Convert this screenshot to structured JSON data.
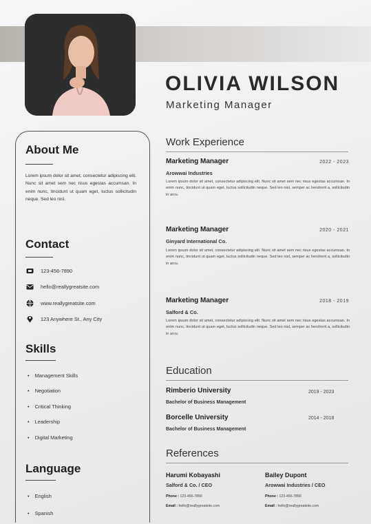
{
  "header": {
    "name": "OLIVIA WILSON",
    "role": "Marketing Manager"
  },
  "about": {
    "heading": "About Me",
    "text": "Lorem ipsum dolor sit amet, consectetur adipiscing elit. Nunc sit amet sem nec risus egestas accumsan. In enim nunc, tincidunt ut quam eget, luctus sollicitudin neque. Sed leo nisl."
  },
  "contact": {
    "heading": "Contact",
    "items": [
      {
        "icon": "phone-icon",
        "text": "123-456-7890"
      },
      {
        "icon": "mail-icon",
        "text": "hello@reallygreatsite.com"
      },
      {
        "icon": "globe-icon",
        "text": "www.reallygreatsite.com"
      },
      {
        "icon": "location-icon",
        "text": "123 Anywhere St., Any City"
      }
    ]
  },
  "skills": {
    "heading": "Skills",
    "items": [
      "Management Skills",
      "Negotiation",
      "Critical Thinking",
      "Leadership",
      "Digital Marketing"
    ]
  },
  "language": {
    "heading": "Language",
    "items": [
      "English",
      "Spanish"
    ]
  },
  "work": {
    "heading": "Work Experience",
    "jobs": [
      {
        "title": "Marketing Manager",
        "company": "Arowwai Industries",
        "dates": "2022 - 2023",
        "desc": "Lorem ipsum dolor sit amet, consectetur adipiscing elit. Nunc sit amet sem nec risus egestas accumsan. In enim nunc, tincidunt ut quam eget, luctus sollicitudin neque. Sed leo nisl, semper ac hendrerit a, sollicitudin in arcu."
      },
      {
        "title": "Marketing Manager",
        "company": "Ginyard International Co.",
        "dates": "2020 - 2021",
        "desc": "Lorem ipsum dolor sit amet, consectetur adipiscing elit. Nunc sit amet sem nec risus egestas accumsan. In enim nunc, tincidunt ut quam eget, luctus sollicitudin neque. Sed leo nisl, semper ac hendrerit a, sollicitudin in arcu."
      },
      {
        "title": "Marketing Manager",
        "company": "Salford & Co.",
        "dates": "2018 - 2019",
        "desc": "Lorem ipsum dolor sit amet, consectetur adipiscing elit. Nunc sit amet sem nec risus egestas accumsan. In enim nunc, tincidunt ut quam eget, luctus sollicitudin neque. Sed leo nisl, semper ac hendrerit a, sollicitudin in arcu."
      }
    ]
  },
  "education": {
    "heading": "Education",
    "items": [
      {
        "school": "Rimberio University",
        "degree": "Bachelor of Business Management",
        "dates": "2019 - 2023"
      },
      {
        "school": "Borcelle University",
        "degree": "Bachelor of Business Management",
        "dates": "2014 - 2018"
      }
    ]
  },
  "references": {
    "heading": "References",
    "people": [
      {
        "name": "Harumi Kobayashi",
        "company": "Salford & Co. / CEO",
        "phone_label": "Phone :",
        "phone": "123-456-7890",
        "email_label": "Email :",
        "email": "hello@reallygreatsite.com"
      },
      {
        "name": "Bailey Dupont",
        "company": "Arowwai Industries / CEO",
        "phone_label": "Phone :",
        "phone": "123-456-7890",
        "email_label": "Email :",
        "email": "hello@reallygreatsite.com"
      }
    ]
  }
}
